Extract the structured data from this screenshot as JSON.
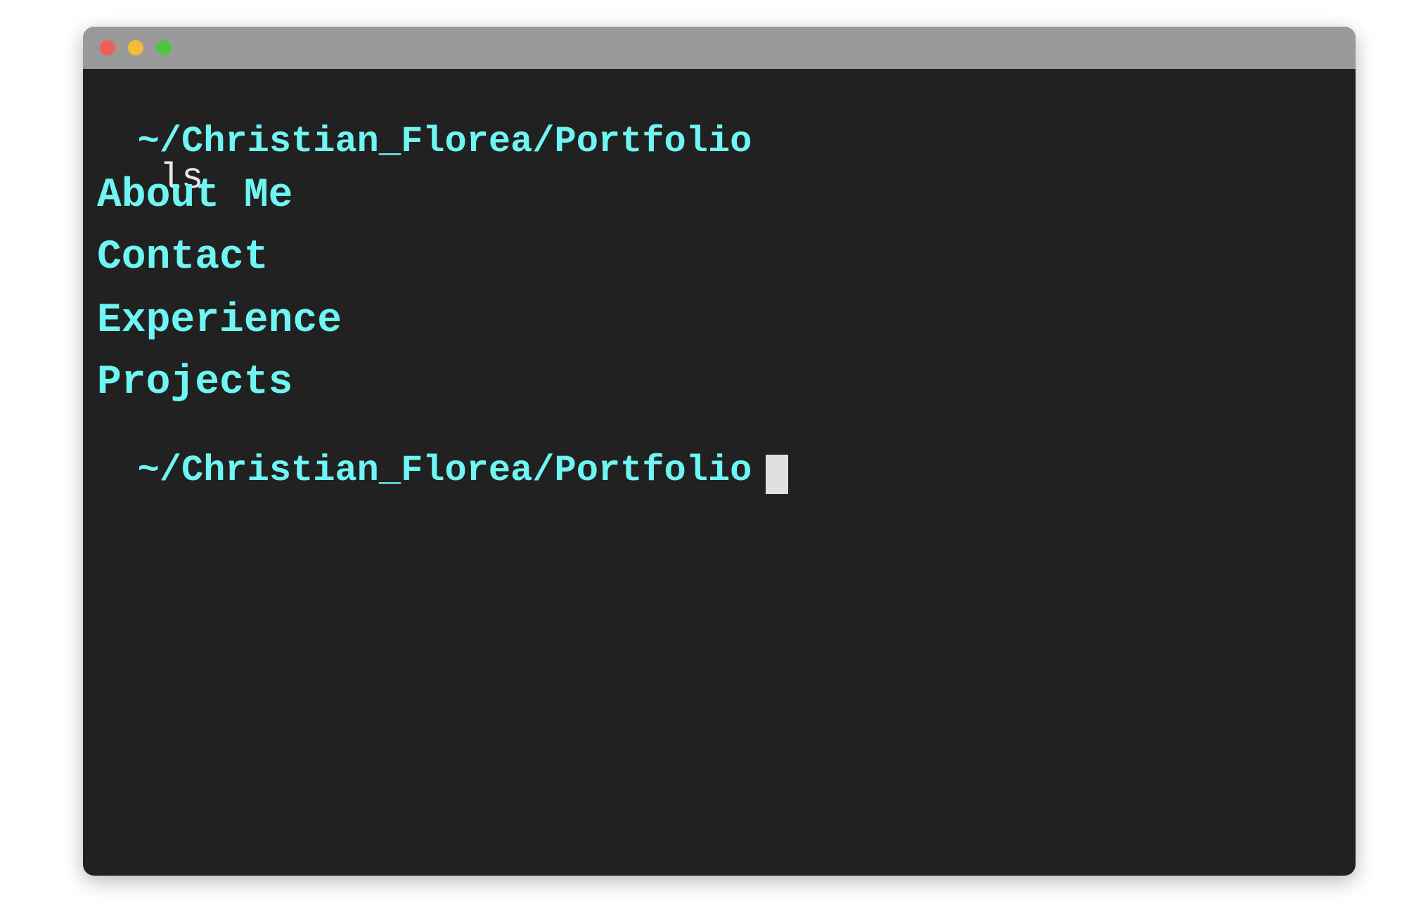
{
  "colors": {
    "terminal_bg": "#212121",
    "titlebar_bg": "#9a9a9a",
    "accent_cyan": "#6ff5f2",
    "command_text": "#e8e8e8",
    "close_dot": "#ee5f5a",
    "minimize_dot": "#f5bb33",
    "zoom_dot": "#4fc442",
    "cursor": "#e0e0e0"
  },
  "titlebar": {
    "buttons": [
      "close",
      "minimize",
      "zoom"
    ]
  },
  "terminal": {
    "prompt_1": {
      "path": "~/Christian_Florea/Portfolio",
      "command": "ls"
    },
    "entries": [
      "About Me",
      "Contact",
      "Experience",
      "Projects"
    ],
    "prompt_2": {
      "path": "~/Christian_Florea/Portfolio"
    }
  }
}
